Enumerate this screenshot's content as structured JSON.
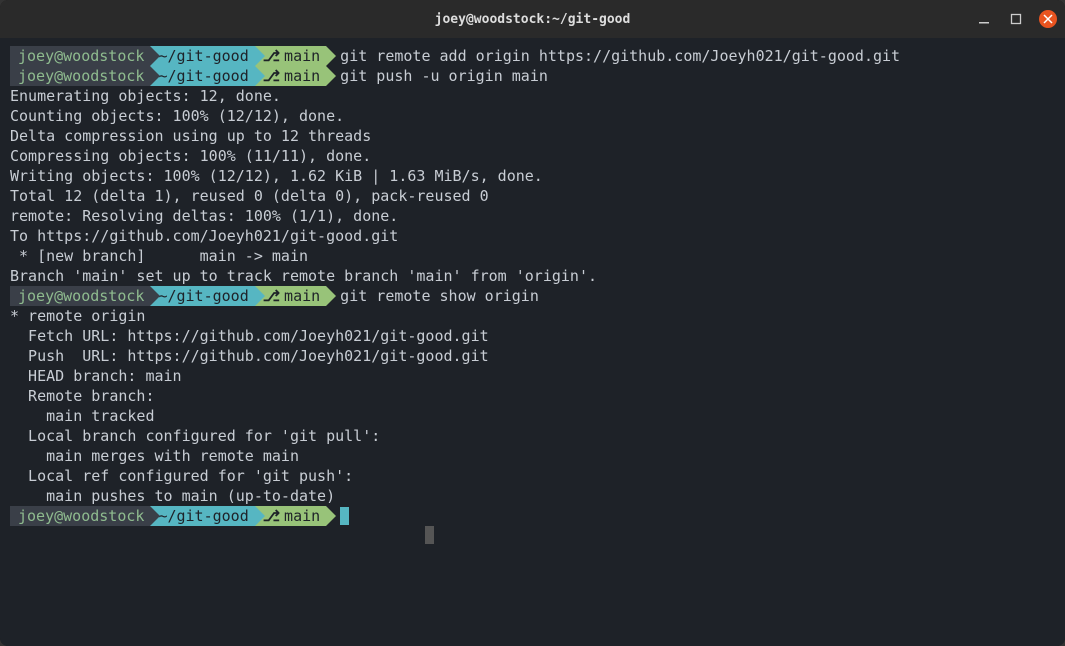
{
  "window": {
    "title": "joey@woodstock:~/git-good"
  },
  "prompt": {
    "user": "joey@woodstock",
    "path": "~/git-good",
    "branch_icon": "⎇",
    "branch": "main"
  },
  "commands": {
    "cmd1": "git remote add origin https://github.com/Joeyh021/git-good.git",
    "cmd2": "git push -u origin main",
    "cmd3": "git remote show origin"
  },
  "output": {
    "push": [
      "Enumerating objects: 12, done.",
      "Counting objects: 100% (12/12), done.",
      "Delta compression using up to 12 threads",
      "Compressing objects: 100% (11/11), done.",
      "Writing objects: 100% (12/12), 1.62 KiB | 1.63 MiB/s, done.",
      "Total 12 (delta 1), reused 0 (delta 0), pack-reused 0",
      "remote: Resolving deltas: 100% (1/1), done.",
      "To https://github.com/Joeyh021/git-good.git",
      " * [new branch]      main -> main",
      "Branch 'main' set up to track remote branch 'main' from 'origin'."
    ],
    "show": [
      "* remote origin",
      "  Fetch URL: https://github.com/Joeyh021/git-good.git",
      "  Push  URL: https://github.com/Joeyh021/git-good.git",
      "  HEAD branch: main",
      "  Remote branch:",
      "    main tracked",
      "  Local branch configured for 'git pull':",
      "    main merges with remote main",
      "  Local ref configured for 'git push':",
      "    main pushes to main (up-to-date)"
    ]
  }
}
